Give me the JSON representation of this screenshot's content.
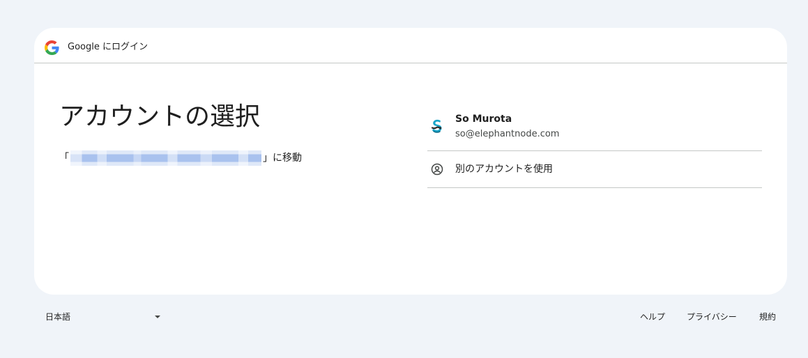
{
  "header": {
    "logo_icon": "google-g-logo-icon",
    "text": "Google にログイン"
  },
  "main": {
    "title": "アカウントの選択",
    "subtitle_prefix": "「",
    "subtitle_suffix": "」に移動"
  },
  "accounts": [
    {
      "name": "So Murota",
      "email": "so@elephantnode.com",
      "avatar_icon": "avatar-icon"
    }
  ],
  "other_account": {
    "label": "別のアカウントを使用",
    "icon": "person-circle-icon"
  },
  "footer": {
    "language": "日本語",
    "links": [
      "ヘルプ",
      "プライバシー",
      "規約"
    ]
  },
  "colors": {
    "background": "#f0f4f9",
    "card": "#ffffff",
    "divider": "#c4c7c5",
    "google_blue": "#4285F4",
    "google_red": "#EA4335",
    "google_yellow": "#FBBC05",
    "google_green": "#34A853"
  }
}
